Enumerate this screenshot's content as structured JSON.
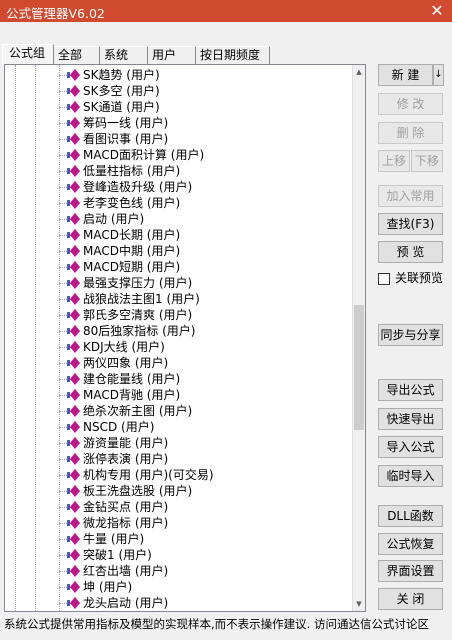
{
  "window": {
    "title": "公式管理器V6.02",
    "close_glyph": "✕"
  },
  "tabs": [
    "公式组",
    "全部",
    "系统",
    "用户",
    "按日期频度"
  ],
  "tree": {
    "items": [
      {
        "name": "SK趋势",
        "tag": "(用户)"
      },
      {
        "name": "SK多空",
        "tag": "(用户)"
      },
      {
        "name": "SK通道",
        "tag": "(用户)"
      },
      {
        "name": "筹码一线",
        "tag": "(用户)"
      },
      {
        "name": "看图识事",
        "tag": "(用户)"
      },
      {
        "name": "MACD面积计算",
        "tag": "(用户)"
      },
      {
        "name": "低量柱指标",
        "tag": "(用户)"
      },
      {
        "name": "登峰造极升级",
        "tag": "(用户)"
      },
      {
        "name": "老李变色线",
        "tag": "(用户)"
      },
      {
        "name": "启动",
        "tag": "(用户)"
      },
      {
        "name": "MACD长期",
        "tag": "(用户)"
      },
      {
        "name": "MACD中期",
        "tag": "(用户)"
      },
      {
        "name": "MACD短期",
        "tag": "(用户)"
      },
      {
        "name": "最强支撑压力",
        "tag": "(用户)"
      },
      {
        "name": "战狼战法主图1",
        "tag": "(用户)"
      },
      {
        "name": "郭氏多空清爽",
        "tag": "(用户)"
      },
      {
        "name": "80后独家指标",
        "tag": "(用户)"
      },
      {
        "name": "KDJ大线",
        "tag": "(用户)"
      },
      {
        "name": "两仪四象",
        "tag": "(用户)"
      },
      {
        "name": "建仓能量线",
        "tag": "(用户)"
      },
      {
        "name": "MACD背驰",
        "tag": "(用户)"
      },
      {
        "name": "绝杀次新主图",
        "tag": "(用户)"
      },
      {
        "name": "NSCD",
        "tag": "(用户)"
      },
      {
        "name": "游资量能",
        "tag": "(用户)"
      },
      {
        "name": "涨停表演",
        "tag": "(用户)"
      },
      {
        "name": "机构专用",
        "tag": "(用户)(可交易)"
      },
      {
        "name": "板王洗盘选股",
        "tag": "(用户)"
      },
      {
        "name": "金钻买点",
        "tag": "(用户)"
      },
      {
        "name": "微龙指标",
        "tag": "(用户)"
      },
      {
        "name": "牛量",
        "tag": "(用户)"
      },
      {
        "name": "突破1",
        "tag": "(用户)"
      },
      {
        "name": "红杏出墙",
        "tag": "(用户)"
      },
      {
        "name": "坤",
        "tag": "(用户)"
      },
      {
        "name": "龙头启动",
        "tag": "(用户)"
      }
    ]
  },
  "buttons": {
    "new": "新 建",
    "new_dropdown": "↓",
    "edit": "修 改",
    "delete": "删 除",
    "move_up": "上移",
    "move_down": "下移",
    "add_common": "加入常用",
    "find": "查找(F3)",
    "preview": "预 览",
    "linked_preview": "关联预览",
    "sync_share": "同步与分享",
    "export": "导出公式",
    "quick_export": "快速导出",
    "import": "导入公式",
    "temp_import": "临时导入",
    "dll": "DLL函数",
    "restore": "公式恢复",
    "ui_settings": "界面设置",
    "close": "关 闭"
  },
  "status": {
    "text": "系统公式提供常用指标及模型的实现样本,而不表示操作建议. 访问通达信公式讨论区"
  },
  "colors": {
    "titlebar": "#d04a2f",
    "icon": "#c0138c"
  }
}
